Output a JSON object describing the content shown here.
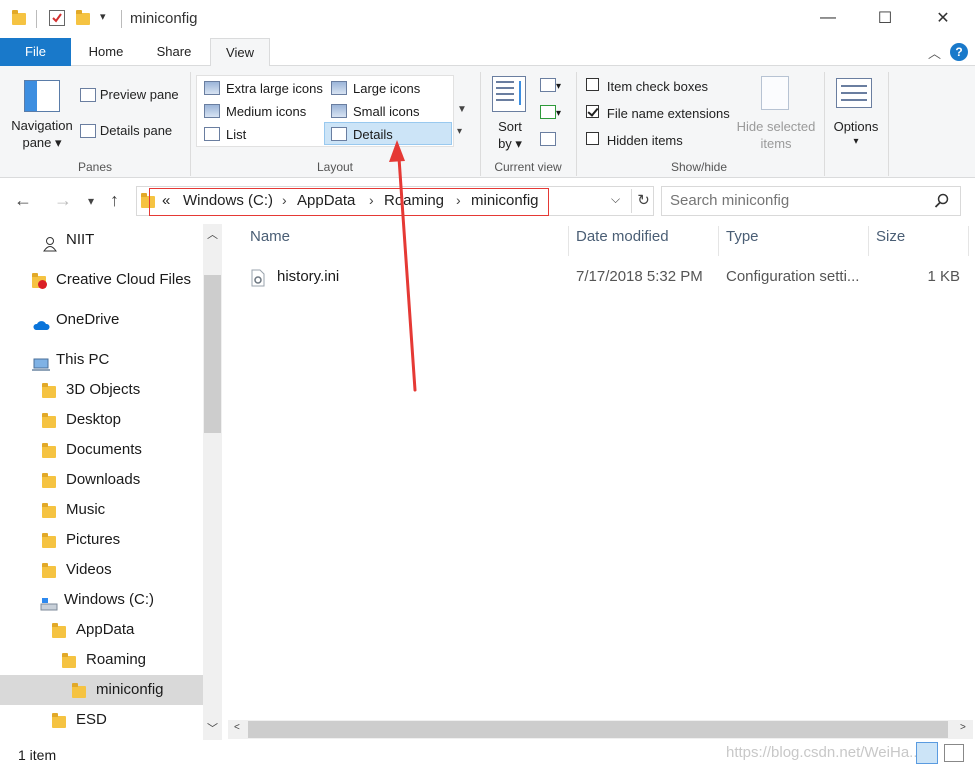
{
  "window": {
    "title": "miniconfig",
    "minimize": "—",
    "maximize": "☐",
    "close": "✕"
  },
  "tabs": [
    {
      "label": "File"
    },
    {
      "label": "Home"
    },
    {
      "label": "Share"
    },
    {
      "label": "View"
    }
  ],
  "ribbon": {
    "panes": {
      "navigation_pane": "Navigation",
      "navigation_pane2": "pane",
      "preview_pane": "Preview pane",
      "details_pane": "Details pane",
      "group_label": "Panes"
    },
    "layout": {
      "items": [
        "Extra large icons",
        "Large icons",
        "Medium icons",
        "Small icons",
        "List",
        "Details"
      ],
      "selected": "Details",
      "group_label": "Layout"
    },
    "current_view": {
      "sort_by": "Sort",
      "sort_by2": "by",
      "group_label": "Current view"
    },
    "show_hide": {
      "item_check_boxes": "Item check boxes",
      "file_name_extensions": "File name extensions",
      "hidden_items": "Hidden items",
      "hide_selected": "Hide selected",
      "hide_selected2": "items",
      "group_label": "Show/hide",
      "checks": {
        "item_check_boxes": false,
        "file_name_extensions": true,
        "hidden_items": false
      }
    },
    "options": {
      "label": "Options"
    }
  },
  "address": {
    "overflow": "«",
    "crumbs": [
      "Windows (C:)",
      "AppData",
      "Roaming",
      "miniconfig"
    ],
    "sep": "›"
  },
  "search": {
    "placeholder": "Search miniconfig"
  },
  "nav_tree": [
    {
      "label": "NIIT",
      "icon": "user-icon"
    },
    {
      "label": "Creative Cloud Files",
      "icon": "creative-cloud-icon"
    },
    {
      "label": "OneDrive",
      "icon": "cloud-icon"
    },
    {
      "label": "This PC",
      "icon": "computer-icon"
    },
    {
      "label": "3D Objects",
      "icon": "folder-icon"
    },
    {
      "label": "Desktop",
      "icon": "folder-icon"
    },
    {
      "label": "Documents",
      "icon": "folder-icon"
    },
    {
      "label": "Downloads",
      "icon": "folder-icon"
    },
    {
      "label": "Music",
      "icon": "folder-icon"
    },
    {
      "label": "Pictures",
      "icon": "folder-icon"
    },
    {
      "label": "Videos",
      "icon": "folder-icon"
    },
    {
      "label": "Windows (C:)",
      "icon": "drive-icon"
    },
    {
      "label": "AppData",
      "icon": "folder-icon"
    },
    {
      "label": "Roaming",
      "icon": "folder-icon"
    },
    {
      "label": "miniconfig",
      "icon": "folder-icon"
    },
    {
      "label": "ESD",
      "icon": "folder-icon"
    }
  ],
  "columns": {
    "name": "Name",
    "date_modified": "Date modified",
    "type": "Type",
    "size": "Size"
  },
  "files": [
    {
      "name": "history.ini",
      "date": "7/17/2018 5:32 PM",
      "type": "Configuration setti...",
      "size": "1 KB"
    }
  ],
  "status": {
    "count": "1 item",
    "watermark": "https://blog.csdn.net/WeiHa..."
  },
  "colors": {
    "accent": "#1979ca",
    "highlight": "#e53935",
    "selection": "#cce4f7"
  }
}
